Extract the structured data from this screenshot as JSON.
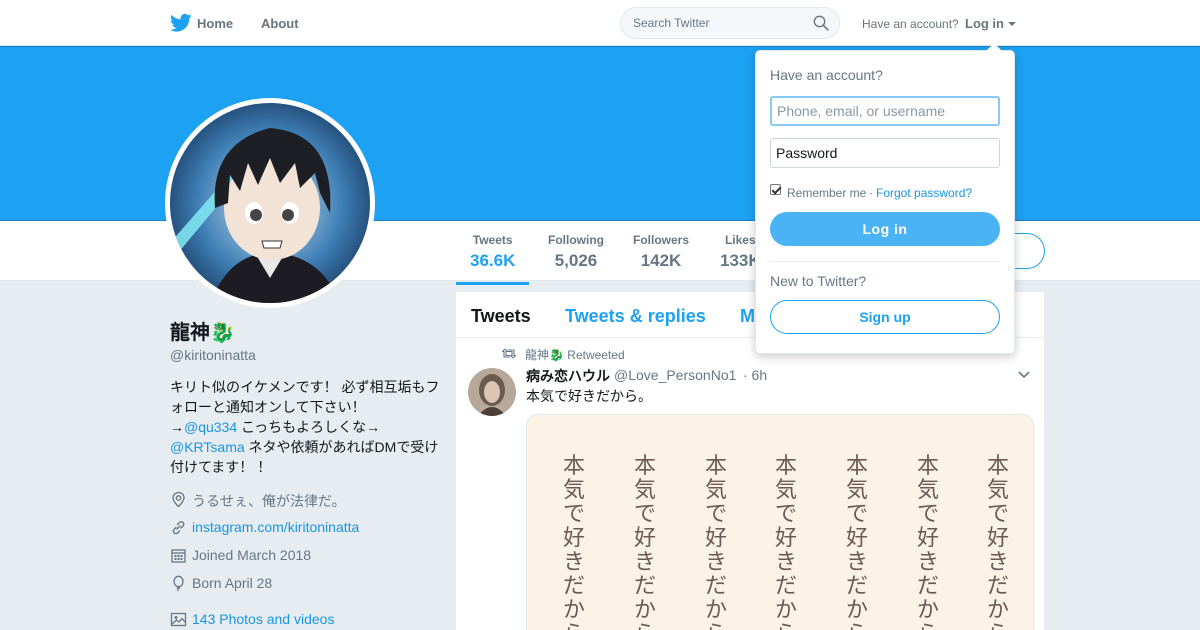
{
  "nav": {
    "home": "Home",
    "about": "About",
    "search_placeholder": "Search Twitter",
    "have_account": "Have an account?",
    "login": "Log in"
  },
  "profile": {
    "name": "龍神🐉",
    "handle": "@kiritoninatta",
    "bio_line1": "キリト似のイケメンです！ 必ず相互垢もフォローと通知オンして下さい！",
    "bio_arrow1": "→",
    "bio_mention1": "@qu334",
    "bio_after1": " こっちもよろしくな→",
    "bio_mention2": "@KRTsama",
    "bio_after2": " ネタや依頼があればDMで受け付けてます！ ！",
    "location": "うるせぇ、俺が法律だ。",
    "website": "instagram.com/kiritoninatta",
    "joined": "Joined March 2018",
    "born": "Born April 28",
    "photos": "143 Photos and videos"
  },
  "stats": [
    {
      "label": "Tweets",
      "value": "36.6K"
    },
    {
      "label": "Following",
      "value": "5,026"
    },
    {
      "label": "Followers",
      "value": "142K"
    },
    {
      "label": "Likes",
      "value": "133K"
    }
  ],
  "timeline": {
    "tabs": [
      "Tweets",
      "Tweets & replies",
      "M"
    ],
    "retweet_by": "龍神🐉 Retweeted",
    "tweet": {
      "author": "病み恋ハウル",
      "handle": "@Love_PersonNo1",
      "time": "· 6h",
      "text": "本気で好きだから。",
      "image_column_text": "本気で好きだから"
    }
  },
  "login_dropdown": {
    "title": "Have an account?",
    "username_placeholder": "Phone, email, or username",
    "password_placeholder": "Password",
    "remember": "Remember me",
    "separator": "·",
    "forgot": "Forgot password?",
    "login_button": "Log in",
    "new_to": "New to Twitter?",
    "signup_button": "Sign up"
  },
  "colors": {
    "accent": "#1da1f2",
    "banner": "#1da1f2",
    "background": "#e6ecf0",
    "link": "#1b95e0"
  }
}
